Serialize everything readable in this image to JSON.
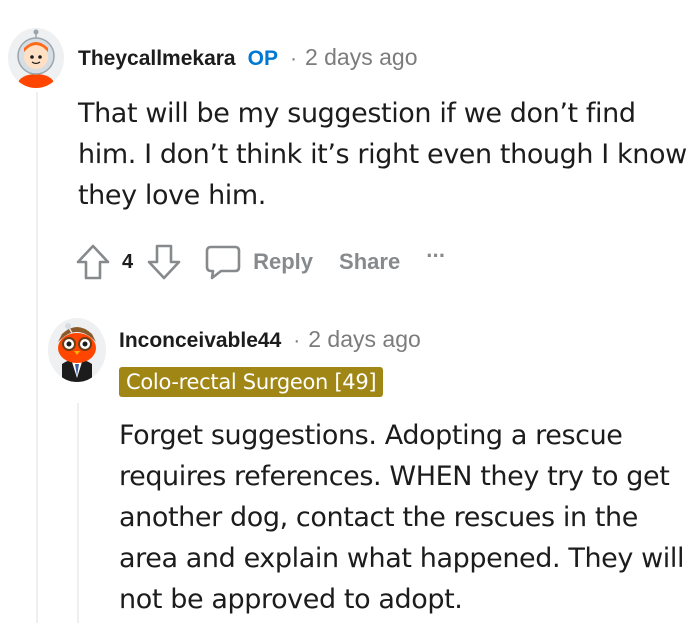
{
  "comment1": {
    "username": "Theycallmekara",
    "op_badge": "OP",
    "separator": "·",
    "time": "2 days ago",
    "body_lines": [
      "That will be my suggestion if we don’t find",
      "him. I don’t think it’s right even though I know",
      "they love him."
    ],
    "votes": "4",
    "reply_label": "Reply",
    "share_label": "Share",
    "more_label": "···",
    "avatar_icon": "snoo-astronaut-avatar"
  },
  "comment2": {
    "username": "Inconceivable44",
    "separator": "·",
    "time": "2 days ago",
    "flair": "Colo-rectal Surgeon [49]",
    "flair_color": "#a08615",
    "body_lines": [
      "Forget suggestions. Adopting a rescue",
      "requires references. WHEN they try to get",
      "another dog, contact the rescues in the",
      "area and explain what happened. They will",
      "not be approved to adopt."
    ],
    "avatar_icon": "snoo-owl-avatar"
  },
  "colors": {
    "op_blue": "#0079d3",
    "meta_gray": "#7c7c7c",
    "action_gray": "#878a8c",
    "thread_line": "#edeff1"
  }
}
